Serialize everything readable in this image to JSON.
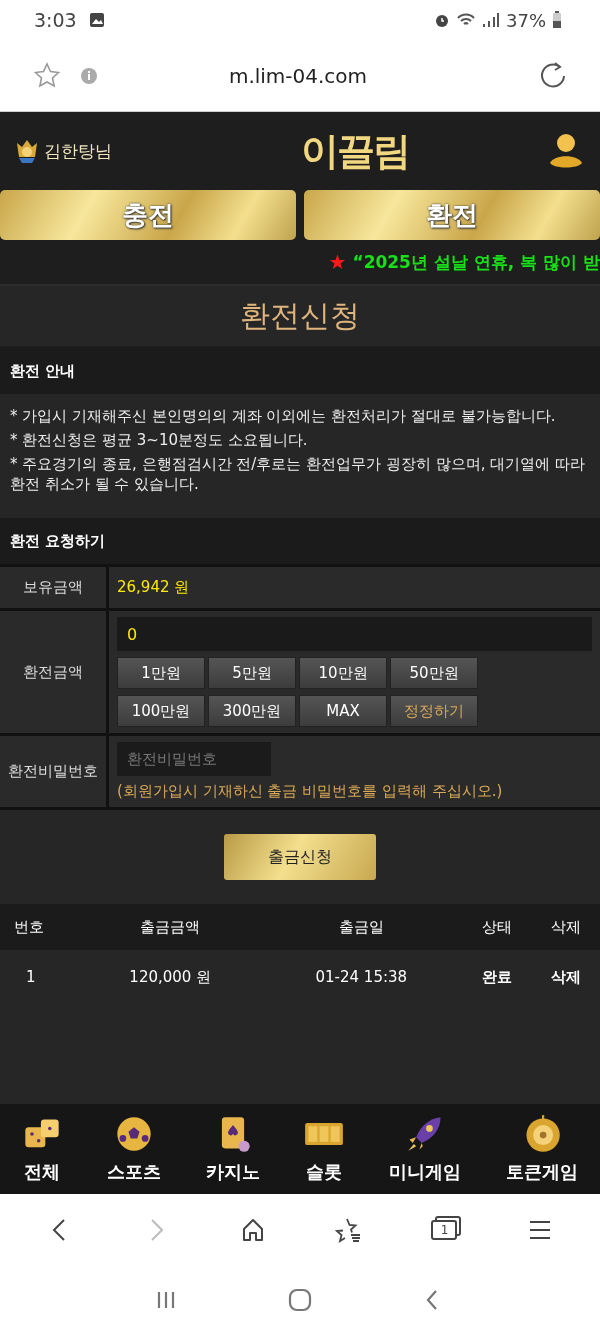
{
  "status_bar": {
    "time": "3:03",
    "battery": "37%"
  },
  "browser": {
    "url": "m.lim-04.com",
    "tab_count": "1",
    "nav": [
      {
        "kind": "back",
        "disabled": false
      },
      {
        "kind": "forward",
        "disabled": true
      },
      {
        "kind": "home",
        "disabled": false
      },
      {
        "kind": "bookmarks",
        "disabled": false
      },
      {
        "kind": "tabs",
        "disabled": false
      },
      {
        "kind": "menu",
        "disabled": false
      }
    ]
  },
  "header": {
    "username": "김한탕님",
    "logo": "이끌림"
  },
  "main_tabs": [
    {
      "label": "충전"
    },
    {
      "label": "환전"
    }
  ],
  "ticker": {
    "star": "★",
    "text": "“2025년 설날 연휴, 복 많이 받"
  },
  "page_title": "환전신청",
  "notice": {
    "title": "환전 안내",
    "lines": [
      "* 가입시 기재해주신 본인명의의 계좌 이외에는 환전처리가 절대로 불가능합니다.",
      "* 환전신청은 평균 3~10분정도 소요됩니다.",
      "* 주요경기의 종료, 은행점검시간 전/후로는 환전업무가 굉장히 많으며, 대기열에 따라 환전 취소가 될 수 있습니다."
    ]
  },
  "request": {
    "title": "환전 요청하기",
    "balance_label": "보유금액",
    "balance": "26,942 원",
    "amount_label": "환전금액",
    "amount_value": "0",
    "amount_buttons": [
      {
        "label": "1만원",
        "kind": "amount"
      },
      {
        "label": "5만원",
        "kind": "amount"
      },
      {
        "label": "10만원",
        "kind": "amount"
      },
      {
        "label": "50만원",
        "kind": "amount"
      },
      {
        "label": "100만원",
        "kind": "amount"
      },
      {
        "label": "300만원",
        "kind": "amount"
      },
      {
        "label": "MAX",
        "kind": "amount"
      },
      {
        "label": "정정하기",
        "kind": "reset"
      }
    ],
    "password_label": "환전비밀번호",
    "password_placeholder": "환전비밀번호",
    "password_hint": "(회원가입시 기재하신 출금 비밀번호를 입력해 주십시오.)",
    "submit": "출금신청"
  },
  "history": {
    "columns": [
      "번호",
      "출금금액",
      "출금일",
      "상태",
      "삭제"
    ],
    "rows": [
      [
        "1",
        "120,000 원",
        "01-24 15:38",
        "완료",
        "삭제"
      ]
    ]
  },
  "bottom_nav": [
    {
      "label": "전체",
      "kind": "dice"
    },
    {
      "label": "스포츠",
      "kind": "ball"
    },
    {
      "label": "카지노",
      "kind": "cards"
    },
    {
      "label": "슬롯",
      "kind": "slot"
    },
    {
      "label": "미니게임",
      "kind": "rocket"
    },
    {
      "label": "토큰게임",
      "kind": "roulette"
    }
  ],
  "system_nav": [
    {
      "kind": "recents"
    },
    {
      "kind": "home"
    },
    {
      "kind": "back"
    }
  ]
}
